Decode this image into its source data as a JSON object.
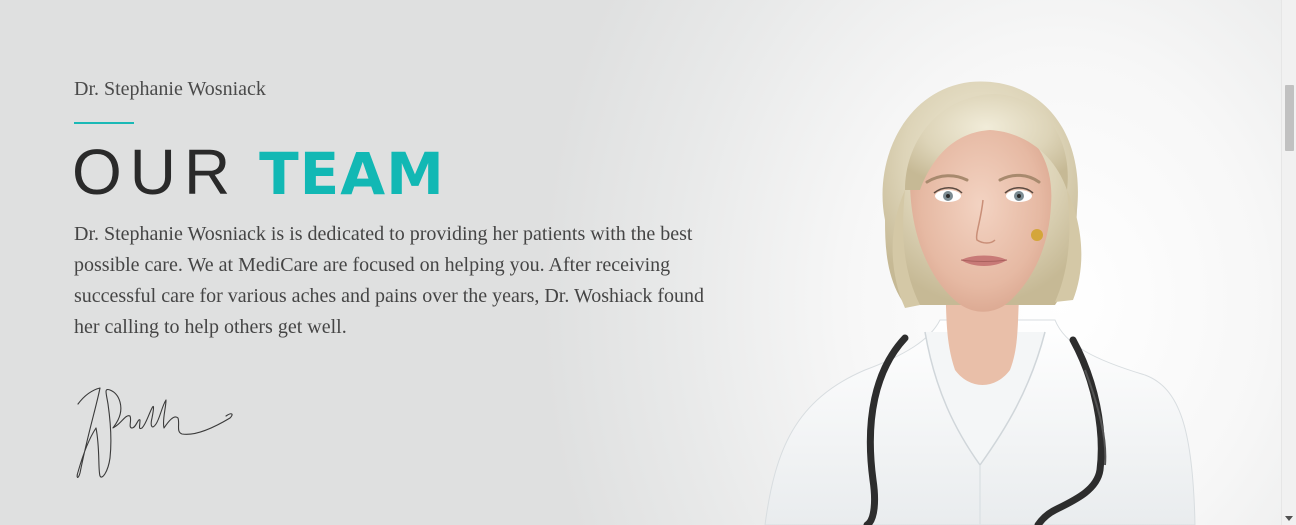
{
  "team_section": {
    "eyebrow": "Dr. Stephanie Wosniack",
    "heading_light": "OUR",
    "heading_bold": "TEAM",
    "bio": "Dr. Stephanie Wosniack is is dedicated to providing her patients with the best possible care. We at MediCare are focused on helping you. After receiving successful care for various aches and pains over the years, Dr. Woshiack found her calling to help others get well."
  },
  "colors": {
    "accent": "#12b8b4",
    "heading_dark": "#2a2a2a",
    "body_text": "#454545",
    "background": "#dfe0e0"
  },
  "icons": {
    "scroll_down": "chevron-down-icon"
  }
}
